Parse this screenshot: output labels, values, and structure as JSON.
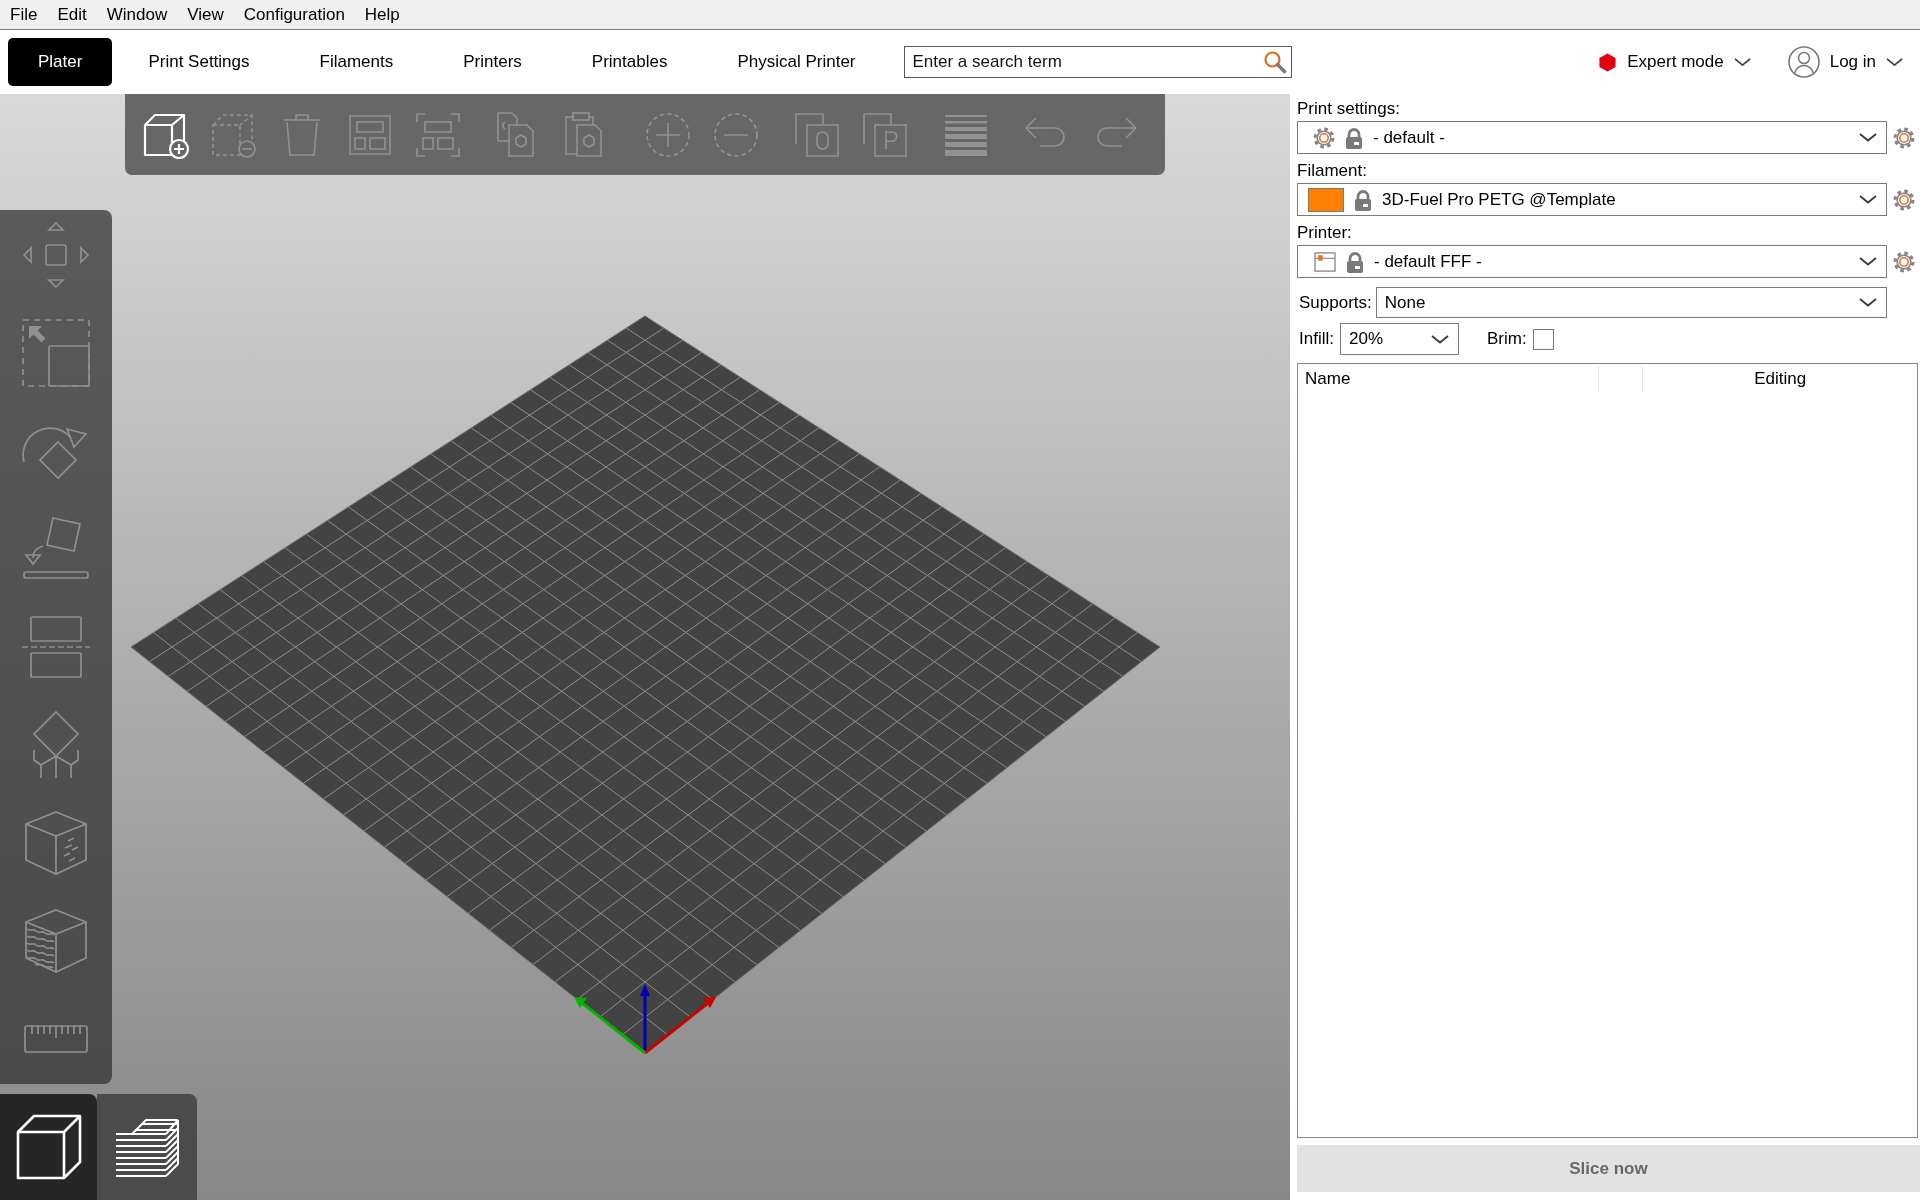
{
  "menu_bar": [
    "File",
    "Edit",
    "Window",
    "View",
    "Configuration",
    "Help"
  ],
  "tabs": [
    {
      "label": "Plater",
      "selected": true
    },
    {
      "label": "Print Settings",
      "selected": false
    },
    {
      "label": "Filaments",
      "selected": false
    },
    {
      "label": "Printers",
      "selected": false
    },
    {
      "label": "Printables",
      "selected": false
    },
    {
      "label": "Physical Printer",
      "selected": false
    }
  ],
  "search": {
    "placeholder": "Enter a search term"
  },
  "mode": {
    "label": "Expert mode"
  },
  "account": {
    "label": "Log in"
  },
  "top_toolbar": [
    {
      "disabled": false
    },
    {
      "disabled": true
    },
    {
      "disabled": true
    },
    {
      "disabled": true
    },
    {
      "disabled": true
    },
    {
      "disabled": true
    },
    {
      "disabled": true
    },
    {
      "disabled": true
    },
    {
      "disabled": true
    },
    {
      "disabled": true
    },
    {
      "disabled": true
    },
    {
      "disabled": true
    },
    {
      "disabled": true
    },
    {
      "disabled": true
    }
  ],
  "view_toggle": [
    {
      "selected": true
    },
    {
      "selected": false
    }
  ],
  "presets": [
    {
      "label": "Print settings:",
      "kind": "print",
      "value": "- default -"
    },
    {
      "label": "Filament:",
      "kind": "filament",
      "value": "3D-Fuel Pro PETG @Template",
      "color": "#ff8000"
    },
    {
      "label": "Printer:",
      "kind": "printer",
      "value": "- default FFF -"
    }
  ],
  "supports": {
    "label": "Supports:",
    "value": "None"
  },
  "infill": {
    "label": "Infill:",
    "value": "20%"
  },
  "brim": {
    "label": "Brim:",
    "checked": false
  },
  "object_list": {
    "columns": [
      "Name",
      "Editing"
    ]
  },
  "slice_button": {
    "label": "Slice now",
    "disabled": true
  }
}
